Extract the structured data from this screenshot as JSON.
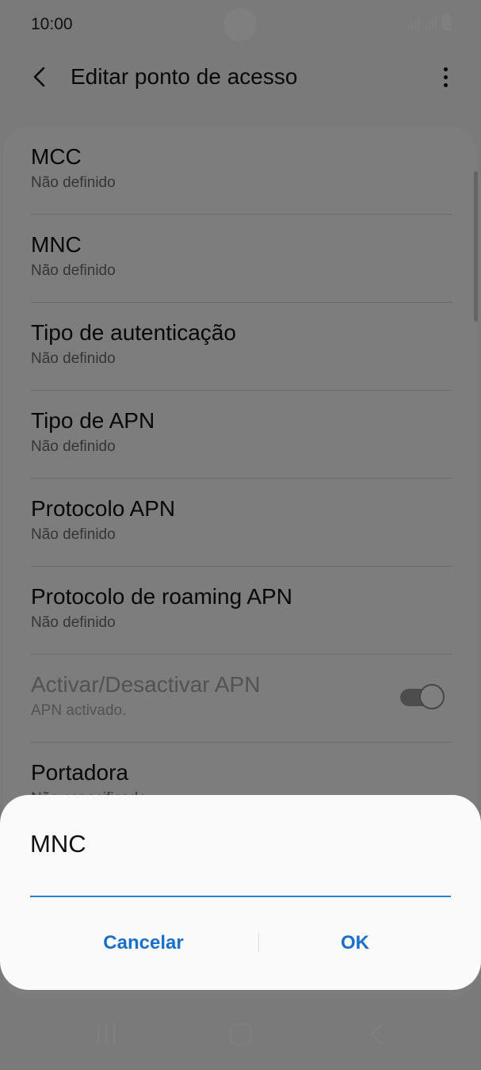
{
  "status_bar": {
    "time": "10:00"
  },
  "app_bar": {
    "title": "Editar ponto de acesso"
  },
  "settings": [
    {
      "label": "MCC",
      "value": "Não definido"
    },
    {
      "label": "MNC",
      "value": "Não definido"
    },
    {
      "label": "Tipo de autenticação",
      "value": "Não definido"
    },
    {
      "label": "Tipo de APN",
      "value": "Não definido"
    },
    {
      "label": "Protocolo APN",
      "value": "Não definido"
    },
    {
      "label": "Protocolo de roaming APN",
      "value": "Não definido"
    },
    {
      "label": "Activar/Desactivar APN",
      "value": "APN activado.",
      "toggle": true,
      "enabled": false
    },
    {
      "label": "Portadora",
      "value": "Não especificado"
    }
  ],
  "dialog": {
    "title": "MNC",
    "input_value": "",
    "cancel_label": "Cancelar",
    "ok_label": "OK"
  },
  "colors": {
    "accent": "#1a6fc9",
    "input_underline": "#2f7fd6"
  }
}
